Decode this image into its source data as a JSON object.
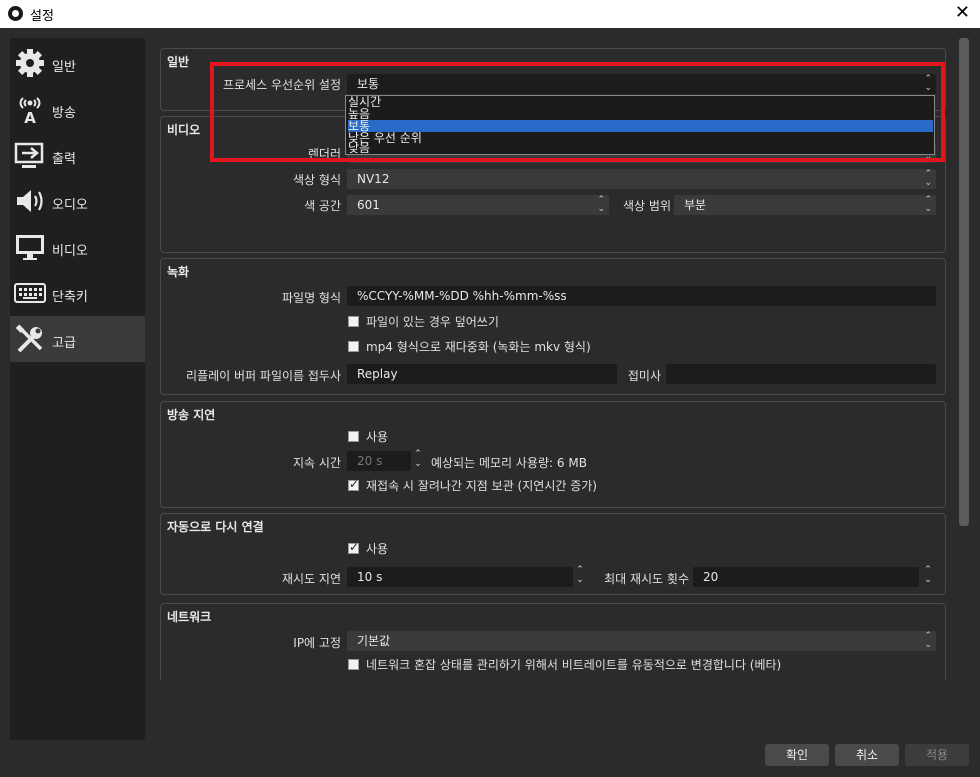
{
  "window": {
    "title": "설정",
    "close": "✕"
  },
  "sidebar": {
    "items": [
      {
        "label": "일반",
        "icon": "gear-icon"
      },
      {
        "label": "방송",
        "icon": "broadcast-antenna-icon"
      },
      {
        "label": "출력",
        "icon": "output-icon"
      },
      {
        "label": "오디오",
        "icon": "speaker-icon"
      },
      {
        "label": "비디오",
        "icon": "monitor-icon"
      },
      {
        "label": "단축키",
        "icon": "keyboard-icon"
      },
      {
        "label": "고급",
        "icon": "tools-icon",
        "active": true
      }
    ]
  },
  "general": {
    "title": "일반",
    "priority_label": "프로세스 우선순위 설정",
    "priority_value": "보통",
    "priority_options": [
      "실시간",
      "높음",
      "보통",
      "낮은 우선 순위",
      "낮음"
    ],
    "priority_selected_index": 2
  },
  "video": {
    "title": "비디오",
    "renderer_label": "렌더러",
    "color_format_label": "색상 형식",
    "color_format_value": "NV12",
    "color_space_label": "색 공간",
    "color_space_value": "601",
    "color_range_label": "색상 범위",
    "color_range_value": "부분"
  },
  "recording": {
    "title": "녹화",
    "filename_label": "파일명 형식",
    "filename_value": "%CCYY-%MM-%DD %hh-%mm-%ss",
    "overwrite_label": "파일이 있는 경우 덮어쓰기",
    "remux_label": "mp4 형식으로 재다중화 (녹화는 mkv 형식)",
    "replay_prefix_label": "리플레이 버퍼 파일이름 접두사",
    "replay_prefix_value": "Replay",
    "suffix_label": "접미사",
    "suffix_value": ""
  },
  "stream_delay": {
    "title": "방송 지연",
    "enable_label": "사용",
    "duration_label": "지속 시간",
    "duration_value": "20 s",
    "memory_text": "예상되는 메모리 사용량: 6 MB",
    "preserve_label": "재접속 시 잘려나간 지점 보관 (지연시간 증가)"
  },
  "reconnect": {
    "title": "자동으로 다시 연결",
    "enable_label": "사용",
    "retry_delay_label": "재시도 지연",
    "retry_delay_value": "10 s",
    "max_retries_label": "최대 재시도 횟수",
    "max_retries_value": "20"
  },
  "network": {
    "title": "네트워크",
    "bind_ip_label": "IP에 고정",
    "bind_ip_value": "기본값",
    "dynamic_bitrate_label": "네트워크 혼잡 상태를 관리하기 위해서 비트레이트를 유동적으로 변경합니다 (베타)"
  },
  "buttons": {
    "ok": "확인",
    "cancel": "취소",
    "apply": "적용"
  },
  "colors": {
    "highlight": "#e0151d",
    "selection": "#2a6bc9",
    "background": "#2b2b2b"
  }
}
